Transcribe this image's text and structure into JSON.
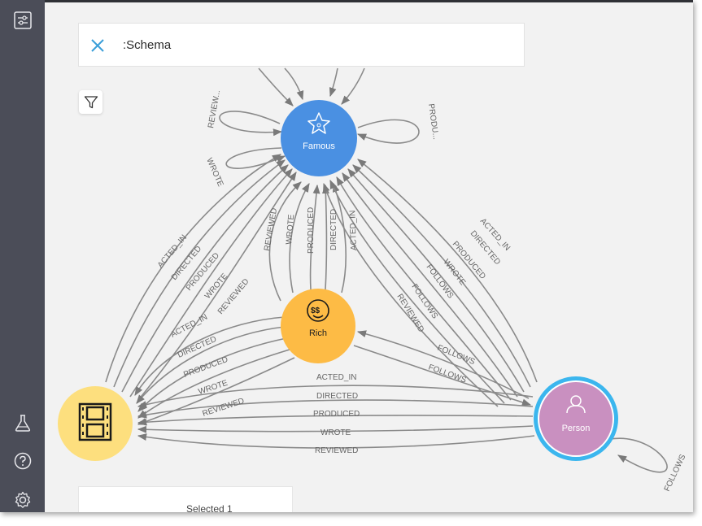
{
  "query": {
    "text": ":Schema"
  },
  "nodes": {
    "famous": {
      "label": "Famous",
      "color": "#4a90e2"
    },
    "rich": {
      "label": "Rich",
      "color": "#fdbb45"
    },
    "person": {
      "label": "Person",
      "color": "#c990c0",
      "ring_color": "#3bb6ee"
    },
    "movie": {
      "label": "",
      "color": "#fddf7e"
    }
  },
  "relationships": {
    "acted_in": "ACTED_IN",
    "directed": "DIRECTED",
    "produced": "PRODUCED",
    "wrote": "WROTE",
    "reviewed": "REVIEWED",
    "follows": "FOLLOWS",
    "reviewed_truncated": "REVIEW...",
    "produced_truncated": "PRODU..."
  },
  "info_panel": {
    "text": "Selected 1"
  },
  "sidebar": {
    "icons": [
      "settings-sliders-icon",
      "flask-icon",
      "help-icon",
      "gear-icon"
    ]
  }
}
